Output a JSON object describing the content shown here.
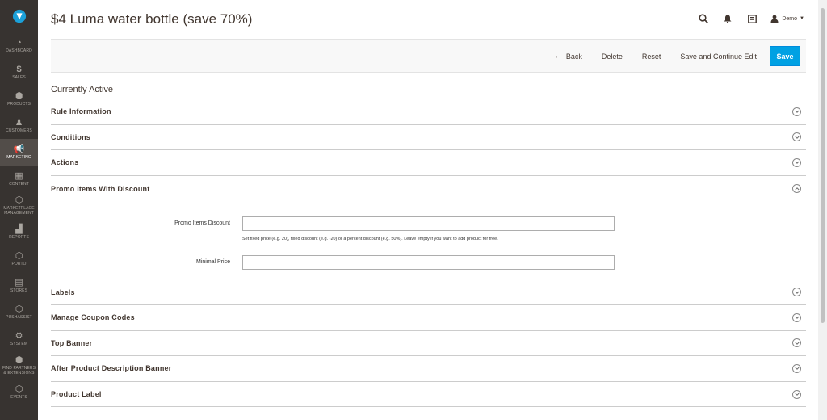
{
  "page": {
    "title": "$4 Luma water bottle (save 70%)"
  },
  "header": {
    "user_name": "Demo",
    "icons": [
      "search-icon",
      "bell-icon",
      "activity-icon",
      "user-icon"
    ]
  },
  "sidebar": {
    "items": [
      {
        "label": "DASHBOARD",
        "icon": "dashboard-icon",
        "glyph": "◔"
      },
      {
        "label": "SALES",
        "icon": "dollar-icon",
        "glyph": "$"
      },
      {
        "label": "PRODUCTS",
        "icon": "cube-icon",
        "glyph": "⬢"
      },
      {
        "label": "CUSTOMERS",
        "icon": "person-icon",
        "glyph": "♟"
      },
      {
        "label": "MARKETING",
        "icon": "megaphone-icon",
        "glyph": "📢"
      },
      {
        "label": "CONTENT",
        "icon": "layout-icon",
        "glyph": "▦"
      },
      {
        "label": "MARKETPLACE\nMANAGEMENT",
        "icon": "hexagon-icon",
        "glyph": "⬡"
      },
      {
        "label": "REPORTS",
        "icon": "bar-chart-icon",
        "glyph": "▟"
      },
      {
        "label": "PORTO",
        "icon": "hexagon-icon",
        "glyph": "⬡"
      },
      {
        "label": "STORES",
        "icon": "store-icon",
        "glyph": "▤"
      },
      {
        "label": "PUSHASSIST",
        "icon": "hexagon-icon",
        "glyph": "⬡"
      },
      {
        "label": "SYSTEM",
        "icon": "gear-icon",
        "glyph": "⚙"
      },
      {
        "label": "FIND PARTNERS\n& EXTENSIONS",
        "icon": "box-icon",
        "glyph": "⬢"
      },
      {
        "label": "EVENTS",
        "icon": "hexagon-icon",
        "glyph": "⬡"
      }
    ]
  },
  "toolbar": {
    "back_label": "Back",
    "delete_label": "Delete",
    "reset_label": "Reset",
    "save_continue_label": "Save and Continue Edit",
    "save_label": "Save"
  },
  "status_text": "Currently Active",
  "sections": [
    "Rule Information",
    "Conditions",
    "Actions",
    "Promo Items With Discount",
    "Labels",
    "Manage Coupon Codes",
    "Top Banner",
    "After Product Description Banner",
    "Product Label"
  ],
  "promo": {
    "discount_label": "Promo Items Discount",
    "discount_value": "",
    "discount_note": "Set fixed price (e.g. 20), fixed discount (e.g. -20) or a percent discount (e.g. 50%). Leave empty if you want to add product for free.",
    "min_price_label": "Minimal Price",
    "min_price_value": ""
  },
  "colors": {
    "accent": "#00a1e3",
    "sidebar": "#373330",
    "sidebar_active": "#524d49"
  }
}
